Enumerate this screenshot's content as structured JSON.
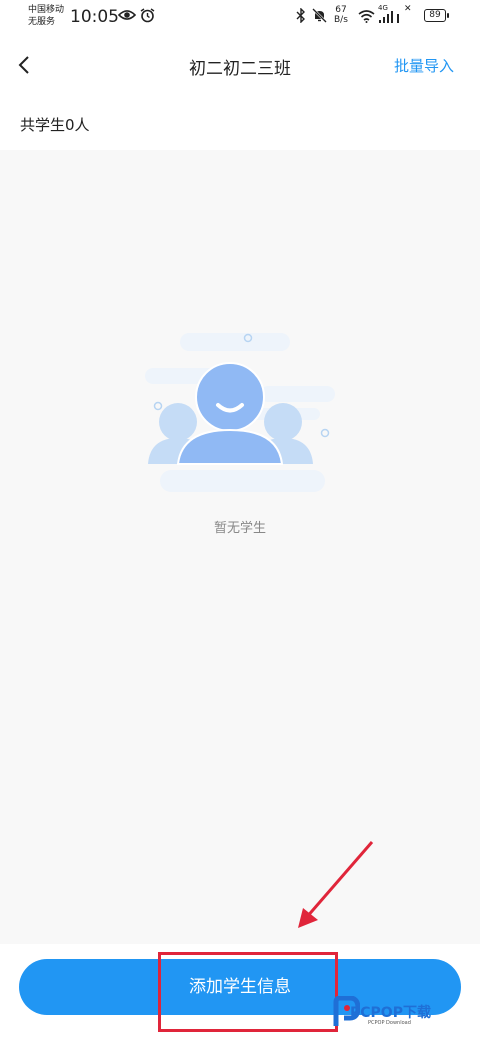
{
  "status_bar": {
    "carrier_line1": "中国移动",
    "carrier_line2": "无服务",
    "time": "10:05",
    "net_speed_value": "67",
    "net_speed_unit": "B/s",
    "network_label": "4G",
    "battery": "89"
  },
  "nav": {
    "title": "初二初二三班",
    "batch_import": "批量导入"
  },
  "summary": {
    "count_text": "共学生0人"
  },
  "empty_state": {
    "text": "暂无学生"
  },
  "bottom": {
    "add_button": "添加学生信息"
  },
  "watermark": {
    "brand": "PCPOP下载",
    "sub": "PCPOP Download"
  },
  "colors": {
    "accent": "#2196f3",
    "annotation": "#e0253a"
  }
}
